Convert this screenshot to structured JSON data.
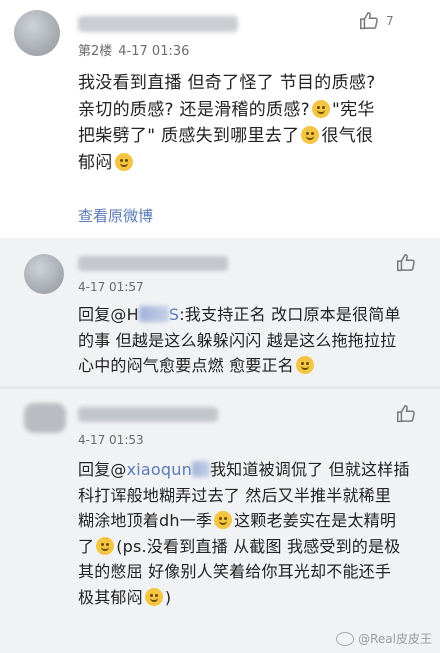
{
  "main_comment": {
    "floor": "第2楼",
    "time": "4-17 01:36",
    "like_count": "7",
    "text": {
      "line1": "我没看到直播 但奇了怪了 节目的质感?",
      "line2a": "亲切的质感? 还是滑稽的质感?",
      "line2b": "\"宪华",
      "line3a": "把柴劈了\" 质感失到哪里去了",
      "line3b": "很气很",
      "line4a": "郁闷"
    },
    "view_original": "查看原微博"
  },
  "reply1": {
    "time": "4-17 01:57",
    "prefix": "回复@H",
    "mention_tail": "S",
    "text_a": ":我支持正名 改口原本是很简单",
    "text_b": "的事 但越是这么躲躲闪闪 越是这么拖拖拉拉",
    "text_c": "心中的闷气愈要点燃 愈要正名"
  },
  "reply2": {
    "time": "4-17 01:53",
    "prefix": "回复@",
    "mention_visible": "xiaoqun",
    "text_a": "我知道被调侃了 但就这样插",
    "text_b": "科打诨般地糊弄过去了 然后又半推半就稀里",
    "text_c1": "糊涂地顶着dh一季",
    "text_c2": "这颗老姜实在是太精明",
    "text_d1": "了",
    "text_d2": "(ps.没看到直播 从截图 我感受到的是极",
    "text_e": "其的憋屈 好像别人笑着给你耳光却不能还手",
    "text_f1": "极其郁闷",
    "text_f2": ")"
  },
  "watermark": "@Real皮皮王",
  "colors": {
    "link": "#5a7ab8",
    "reply_bg": "#f1f2f4",
    "emoji": "#f4c542"
  }
}
